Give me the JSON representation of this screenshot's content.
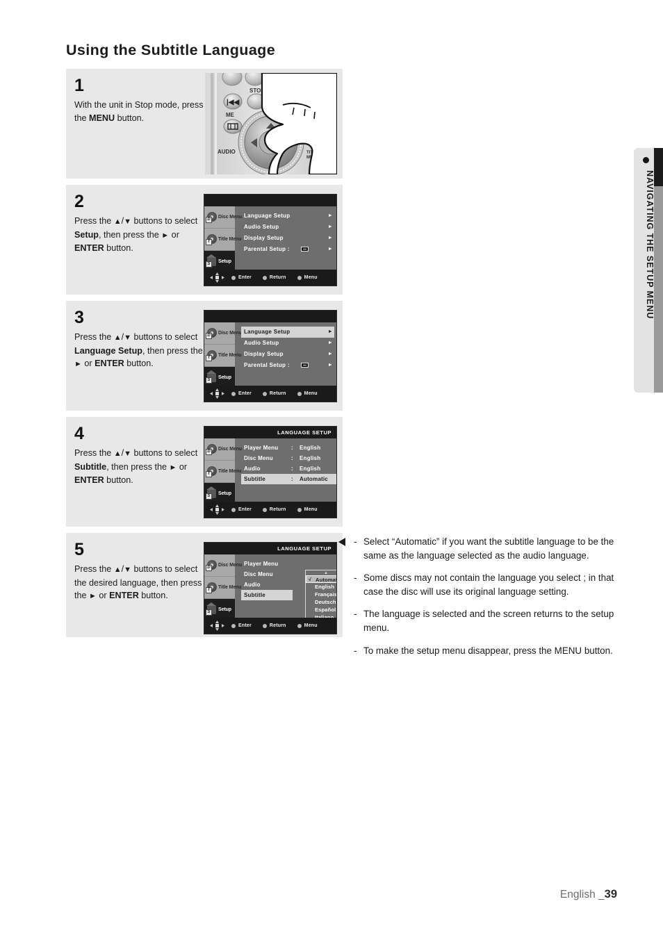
{
  "page": {
    "title": "Using the Subtitle Language",
    "footer_label": "English _",
    "footer_page": "39",
    "side_tab": "NAVIGATING THE SETUP MENU"
  },
  "steps": [
    {
      "number": "1",
      "text_parts": [
        "With the unit in Stop mode, press the ",
        "MENU",
        " button."
      ],
      "illustration": "remote-control-photo"
    },
    {
      "number": "2",
      "text_parts": [
        "Press the ",
        "▲",
        "/",
        "▼",
        " buttons to select ",
        "Setup",
        ", then press the ",
        "►",
        " or ",
        "ENTER",
        " button."
      ],
      "illustration": "setup-menu-screen"
    },
    {
      "number": "3",
      "text_parts": [
        "Press the ",
        "▲",
        "/",
        "▼",
        " buttons to select ",
        "Language Setup",
        ", then press the ",
        "►",
        " or ",
        "ENTER",
        " button."
      ],
      "illustration": "setup-menu-screen-language-highlighted"
    },
    {
      "number": "4",
      "text_parts": [
        "Press the ",
        "▲",
        "/",
        "▼",
        " buttons to select ",
        "Subtitle",
        ", then press the ",
        "►",
        " or ",
        "ENTER",
        " button."
      ],
      "illustration": "language-setup-screen"
    },
    {
      "number": "5",
      "text_parts": [
        "Press the ",
        "▲",
        "/",
        "▼",
        " buttons to select the desired language, then press the ",
        "►",
        " or ",
        "ENTER",
        " button."
      ],
      "illustration": "language-setup-dropdown-screen"
    }
  ],
  "osd": {
    "sidebar": [
      {
        "label": "Disc Menu",
        "icon": "disc-menu-icon",
        "active": false
      },
      {
        "label": "Title Menu",
        "icon": "title-menu-icon",
        "active": false
      },
      {
        "label": "Setup",
        "icon": "setup-icon",
        "active": true
      }
    ],
    "bottom_bar": {
      "dpad": "dpad-icon",
      "hints": [
        "Enter",
        "Return",
        "Menu"
      ]
    },
    "setup_menu": {
      "title": "",
      "items": [
        {
          "label": "Language Setup",
          "caret": "►",
          "lock": false
        },
        {
          "label": "Audio Setup",
          "caret": "►",
          "lock": false
        },
        {
          "label": "Display Setup",
          "caret": "►",
          "lock": false
        },
        {
          "label": "Parental Setup :",
          "caret": "►",
          "lock": true
        }
      ],
      "selected_index_step2": -1,
      "selected_index_step3": 0
    },
    "language_setup": {
      "title": "LANGUAGE SETUP",
      "rows": [
        {
          "label": "Player Menu",
          "colon": ":",
          "value": "English"
        },
        {
          "label": "Disc Menu",
          "colon": ":",
          "value": "English"
        },
        {
          "label": "Audio",
          "colon": ":",
          "value": "English"
        },
        {
          "label": "Subtitle",
          "colon": ":",
          "value": "Automatic"
        }
      ],
      "selected_index": 3,
      "dropdown": {
        "up_arrow": "▲",
        "down_arrow": "▼",
        "check_mark": "√",
        "options": [
          "Automatic",
          "English",
          "Français",
          "Deutsch",
          "Español",
          "Italiano"
        ],
        "selected_option": "Automatic"
      }
    }
  },
  "notes": [
    {
      "bullet": "-",
      "text": "Select “Automatic” if you want the subtitle language to be the same as the language selected as the audio language."
    },
    {
      "bullet": "-",
      "text": "Some discs may not contain the language you select ; in that case the disc will use its original language setting."
    },
    {
      "bullet": "-",
      "text": "The language is selected and the screen returns to the setup menu."
    },
    {
      "bullet": "-",
      "text": "To make the setup menu disappear, press the MENU button."
    }
  ]
}
